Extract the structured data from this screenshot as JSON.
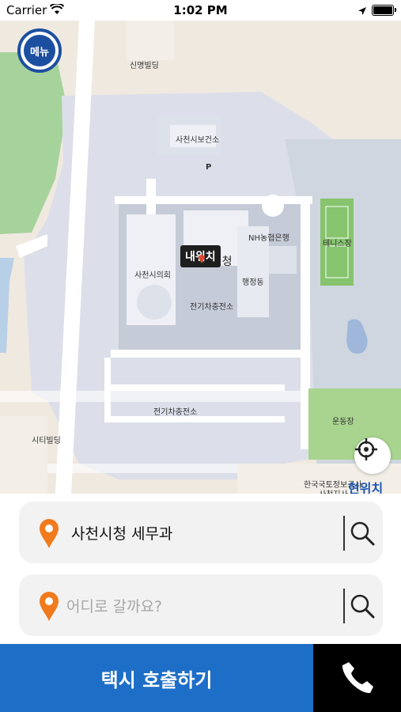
{
  "status_bar": {
    "carrier": "Carrier",
    "time": "1:02 PM"
  },
  "map": {
    "menu_label": "메뉴",
    "my_location_label": "내위치",
    "current_location_label": "현위치",
    "labels": {
      "shinmyung": "신명빌딩",
      "health_center": "사천시보건소",
      "parking": "P",
      "nh_bank": "NH농협은행",
      "tennis": "테니스장",
      "city_hall": "사천시청",
      "council": "사천시의회",
      "admin_bldg": "행정동",
      "ev_station_1": "전기차충전소",
      "ev_station_2": "전기차충전소",
      "field": "운동장",
      "city_bldg": "시티빌딩",
      "kr_info": "한국국토정보공사",
      "kr_info_sub": "사천지사"
    }
  },
  "origin": {
    "value": "사천시청 세무과"
  },
  "destination": {
    "placeholder": "어디로 갈까요?"
  },
  "call_button": {
    "label": "택시 호출하기"
  },
  "colors": {
    "accent": "#1d6ec7",
    "menu": "#1d4fa0",
    "pin": "#f07a1c"
  }
}
